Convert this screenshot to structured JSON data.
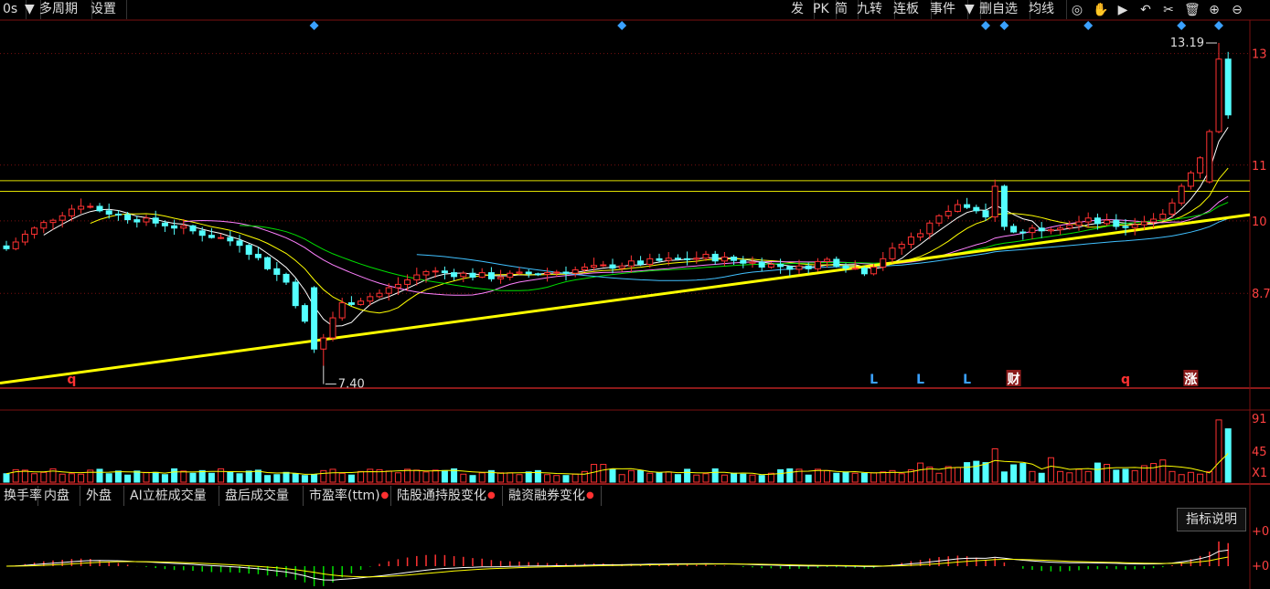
{
  "toolbar": {
    "left": [
      {
        "label": "0s",
        "name": "period-label",
        "x": 0,
        "w": 22
      },
      {
        "label": "▼",
        "name": "period-dropdown",
        "x": 24,
        "w": 14
      },
      {
        "label": "多周期",
        "name": "multi-period-button",
        "x": 40,
        "w": 54
      },
      {
        "label": "设置",
        "name": "settings-button",
        "x": 96,
        "w": 36
      }
    ],
    "right": [
      {
        "label": "发",
        "name": "fa-button",
        "x": 862,
        "w": 22
      },
      {
        "label": "PK",
        "name": "pk-button",
        "x": 886,
        "w": 22
      },
      {
        "label": "简",
        "name": "jian-button",
        "x": 910,
        "w": 22
      },
      {
        "label": "九转",
        "name": "jiuzhuan-button",
        "x": 934,
        "w": 38
      },
      {
        "label": "连板",
        "name": "lianban-button",
        "x": 974,
        "w": 38
      },
      {
        "label": "事件",
        "name": "events-button",
        "x": 1014,
        "w": 38
      },
      {
        "label": "▼",
        "name": "events-dropdown",
        "x": 1052,
        "w": 14
      },
      {
        "label": "删自选",
        "name": "remove-watchlist-button",
        "x": 1068,
        "w": 52
      },
      {
        "label": "均线",
        "name": "ma-button",
        "x": 1122,
        "w": 38
      }
    ],
    "icons": [
      {
        "name": "eye-icon",
        "glyph": "◎"
      },
      {
        "name": "hand-icon",
        "glyph": "✋"
      },
      {
        "name": "play-icon",
        "glyph": "▶"
      },
      {
        "name": "undo-icon",
        "glyph": "↶"
      },
      {
        "name": "cut-icon",
        "glyph": "✂"
      },
      {
        "name": "trash-icon",
        "glyph": "🗑"
      },
      {
        "name": "zoom-in-icon",
        "glyph": "⊕"
      },
      {
        "name": "zoom-out-icon",
        "glyph": "⊖"
      }
    ]
  },
  "indicator_tabs": [
    {
      "label": "换手率",
      "dot": false
    },
    {
      "label": "内盘",
      "dot": false
    },
    {
      "label": "外盘",
      "dot": false
    },
    {
      "label": "AI立桩成交量",
      "dot": false
    },
    {
      "label": "盘后成交量",
      "dot": false
    },
    {
      "label": "市盈率(ttm)",
      "dot": true
    },
    {
      "label": "陆股通持股变化",
      "dot": true
    },
    {
      "label": "融资融券变化",
      "dot": true
    }
  ],
  "explain_button": "指标说明",
  "colors": {
    "up": "#ff3232",
    "down": "#54ffff",
    "trend": "#ffff00",
    "ma5": "#ffffff",
    "ma10": "#ffff00",
    "ma20": "#ff80ff",
    "ma30": "#00e000",
    "ma60": "#40c0ff",
    "grid": "#7a1010"
  },
  "chart_data": {
    "type": "candlestick",
    "yaxis_labels": [
      "13",
      "11",
      "10",
      "8.7"
    ],
    "ylim": [
      7.0,
      13.6
    ],
    "high_annotation": "13.19",
    "low_annotation": "7.40",
    "horizontal_lines": [
      10.72,
      10.53
    ],
    "trendline": {
      "start": [
        0,
        7.09
      ],
      "end": [
        131,
        10.11
      ]
    },
    "event_markers": [
      {
        "index": 7,
        "label": "q"
      },
      {
        "index": 93,
        "label": "L"
      },
      {
        "index": 98,
        "label": "L"
      },
      {
        "index": 103,
        "label": "L"
      },
      {
        "index": 108,
        "label": "财"
      },
      {
        "index": 120,
        "label": "q"
      },
      {
        "index": 127,
        "label": "涨"
      }
    ],
    "top_markers": [
      33,
      66,
      105,
      107,
      116,
      126,
      130
    ],
    "volume_axis_labels": [
      "91",
      "45",
      "X1"
    ],
    "macd_axis_labels": [
      "+0",
      "+0"
    ],
    "ma_legend": [],
    "candles": []
  }
}
